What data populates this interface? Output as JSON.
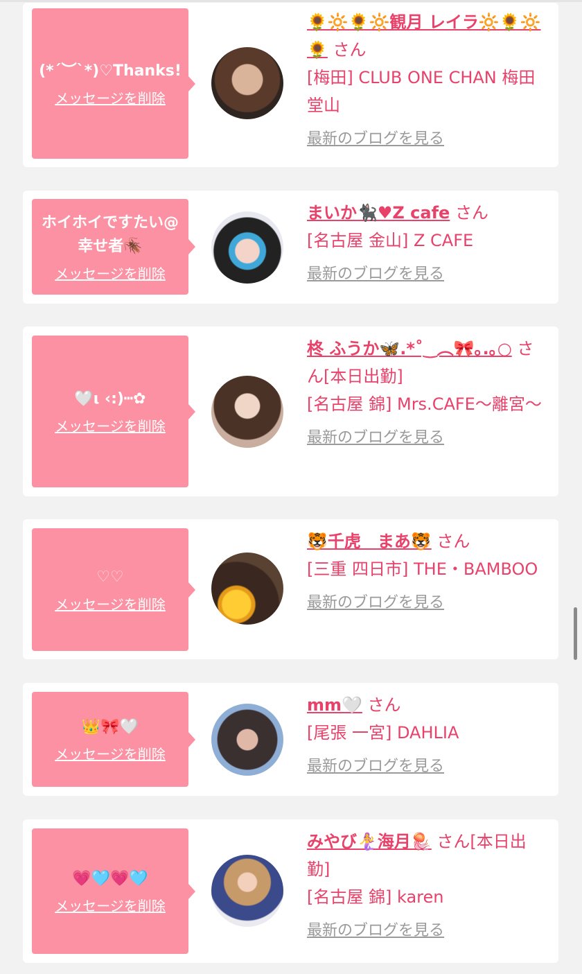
{
  "delete_label": "メッセージを削除",
  "blog_label": "最新のブログを見る",
  "colors": {
    "accent": "#e8426b",
    "bubble": "#fb91a2",
    "link_gray": "#9a9a9a"
  },
  "entries": [
    {
      "message": "(*´︶`*)♡Thanks!",
      "name": "🌻🔆🌻🔆観月 レイラ🔆🌻🔆🌻",
      "san": "さん",
      "shop": "[梅田] CLUB ONE CHAN 梅田堂山"
    },
    {
      "message": "ホイホイですたい@幸せ者🪳",
      "name": "まいか🐈‍⬛♥Z cafe",
      "san": "さん",
      "shop": "[名古屋 金山] Z CAFE"
    },
    {
      "message": "🤍ι ‹:)┅✿",
      "name": "柊 ふうか🦋.*˚‿︵🎀｡.｡○",
      "san": "さん[本日出勤]",
      "shop": "[名古屋 錦] Mrs.CAFE〜離宮〜"
    },
    {
      "message": "♡♡",
      "name": "🐯千虎　まあ🐯",
      "san": "さん",
      "shop": "[三重 四日市] THE・BAMBOO"
    },
    {
      "message": "👑🎀🤍",
      "name": "mm🤍",
      "san": "さん",
      "shop": "[尾張 一宮] DAHLIA"
    },
    {
      "message": "💗🩵💗🩵",
      "name": "みやび🧜‍♀️海月🪼",
      "san": "さん[本日出勤]",
      "shop": "[名古屋 錦] karen"
    }
  ]
}
